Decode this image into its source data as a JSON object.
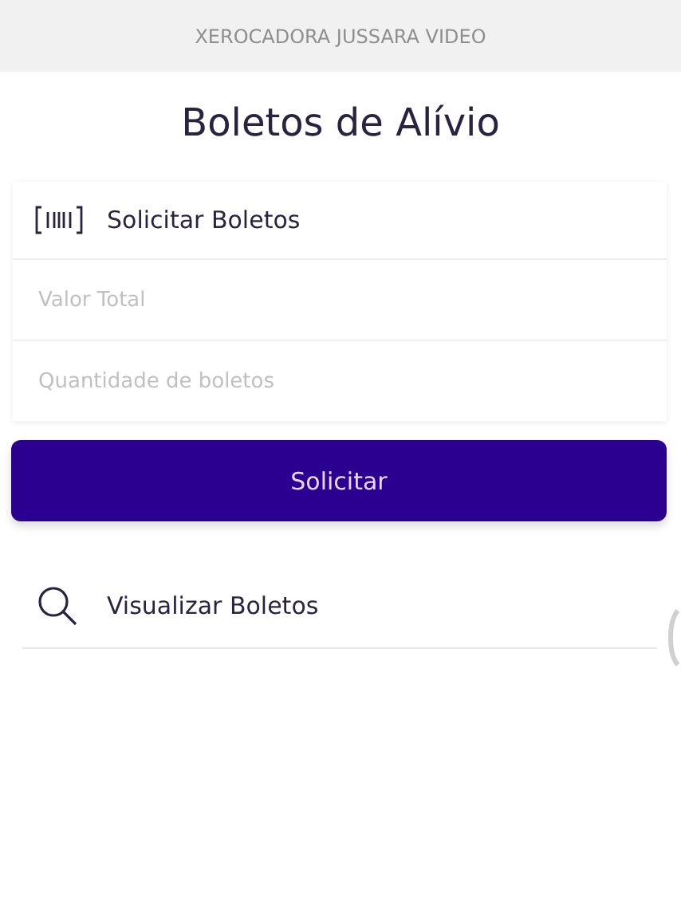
{
  "header": {
    "title": "XEROCADORA JUSSARA VIDEO"
  },
  "page_title": "Boletos de Alívio",
  "request_card": {
    "title": "Solicitar Boletos",
    "fields": [
      {
        "placeholder": "Valor Total"
      },
      {
        "placeholder": "Quantidade de boletos"
      }
    ]
  },
  "submit_button": "Solicitar",
  "view_link": "Visualizar Boletos"
}
